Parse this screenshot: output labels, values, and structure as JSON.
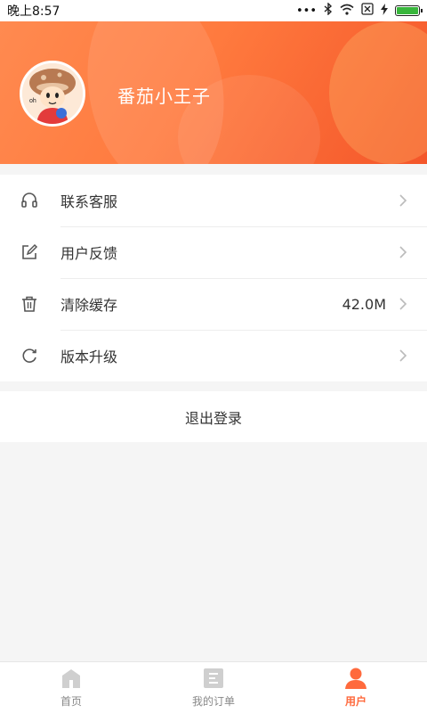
{
  "status_bar": {
    "time": "晚上8:57",
    "dots": "•••",
    "bluetooth": "bluetooth-icon",
    "wifi": "wifi-icon",
    "sim": "sim-icon",
    "charging": "lightning-icon",
    "battery_level": 1.0,
    "battery_color": "#38b63c"
  },
  "profile": {
    "username": "番茄小王子",
    "avatar_icon": "avatar"
  },
  "menu": {
    "items": [
      {
        "label": "联系客服",
        "icon": "headset-icon",
        "value": ""
      },
      {
        "label": "用户反馈",
        "icon": "edit-icon",
        "value": ""
      },
      {
        "label": "清除缓存",
        "icon": "trash-icon",
        "value": "42.0M"
      },
      {
        "label": "版本升级",
        "icon": "refresh-icon",
        "value": ""
      }
    ]
  },
  "logout": {
    "label": "退出登录"
  },
  "tabbar": {
    "tabs": [
      {
        "label": "首页",
        "icon": "home-icon",
        "active": false
      },
      {
        "label": "我的订单",
        "icon": "orders-icon",
        "active": false
      },
      {
        "label": "用户",
        "icon": "user-icon",
        "active": true
      }
    ],
    "active_color": "#ff6a3d"
  },
  "colors": {
    "header_start": "#ff8a50",
    "header_end": "#f4562a"
  }
}
